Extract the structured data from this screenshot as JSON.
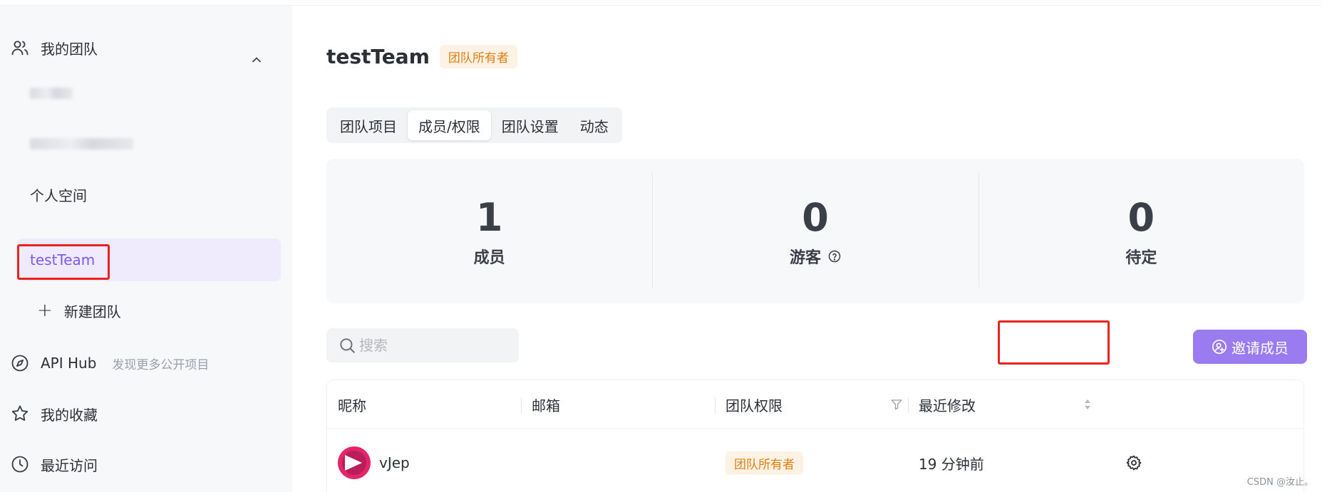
{
  "sidebar": {
    "my_team_label": "我的团队",
    "personal_space": "个人空间",
    "active_team": "testTeam",
    "new_team": "新建团队",
    "api_hub": "API Hub",
    "api_hub_hint": "发现更多公开项目",
    "favorites": "我的收藏",
    "recent": "最近访问"
  },
  "header": {
    "team_name": "testTeam",
    "role_badge": "团队所有者"
  },
  "tabs": [
    {
      "label": "团队项目"
    },
    {
      "label": "成员/权限"
    },
    {
      "label": "团队设置"
    },
    {
      "label": "动态"
    }
  ],
  "stats": [
    {
      "value": "1",
      "label": "成员"
    },
    {
      "value": "0",
      "label": "游客"
    },
    {
      "value": "0",
      "label": "待定"
    }
  ],
  "search": {
    "placeholder": "搜索"
  },
  "invite_button": "邀请成员",
  "table": {
    "columns": [
      "昵称",
      "邮箱",
      "团队权限",
      "最近修改"
    ],
    "rows": [
      {
        "nickname": "vJep",
        "email": "",
        "role": "团队所有者",
        "modified": "19 分钟前"
      }
    ]
  },
  "watermark": "CSDN @汝止。",
  "colors": {
    "accent": "#9b7cf0",
    "highlight": "#e8231f",
    "badge_text": "#e07e12"
  }
}
